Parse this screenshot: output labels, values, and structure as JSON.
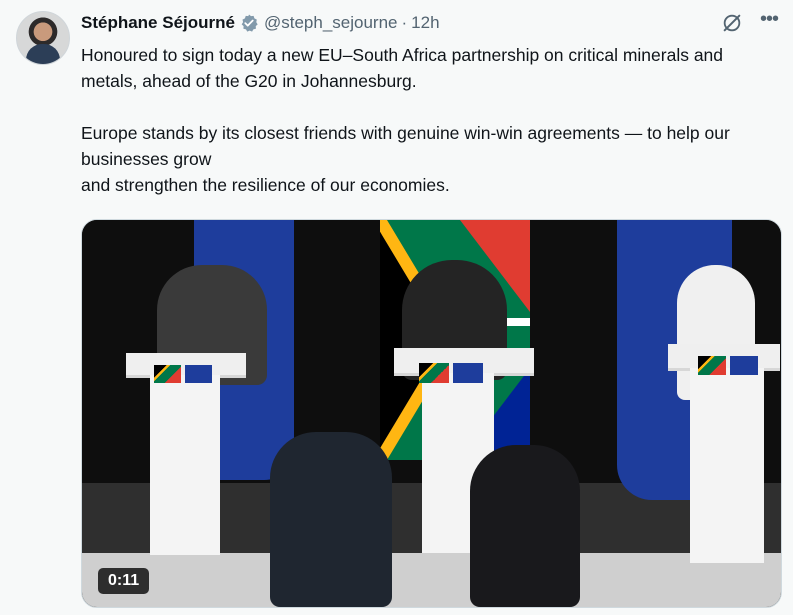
{
  "author": {
    "name": "Stéphane Séjourné",
    "handle": "@steph_sejourne",
    "separator": "·",
    "time": "12h",
    "verified": true
  },
  "tweet": {
    "paragraph1": "Honoured to sign today a new EU–South Africa partnership on critical minerals and metals, ahead of the G20 in Johannesburg.",
    "paragraph2_line1": "Europe stands by its closest friends with genuine win-win agreements — to help our businesses grow",
    "paragraph2_line2": "and strengthen the resilience of our economies."
  },
  "media": {
    "duration": "0:11"
  },
  "icons": {
    "verified": "verified-badge-icon",
    "grok": "grok-icon",
    "more": "more-icon"
  },
  "colors": {
    "eu_blue": "#1e3d9c",
    "background": "#f7f9f9",
    "muted_text": "#536471",
    "verified": "#829aab"
  }
}
